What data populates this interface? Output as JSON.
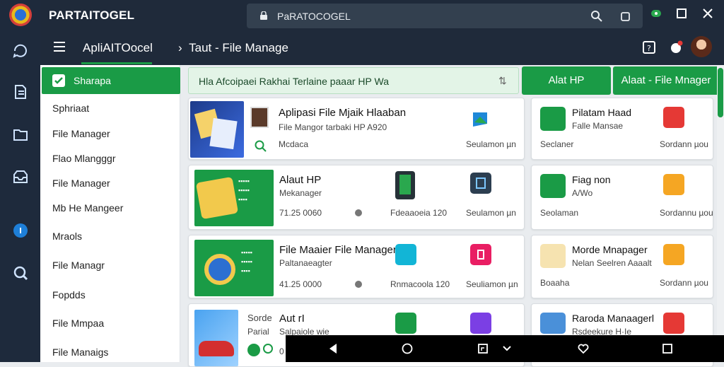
{
  "rail": {
    "icons": [
      "logo-icon",
      "chat-icon",
      "bookmark-icon",
      "folder-icon",
      "inbox-icon",
      "info-icon",
      "settings-icon"
    ]
  },
  "topbar": {
    "brand": "PARTAITOGEL",
    "url": "PaRATOCOGEL"
  },
  "appbar": {
    "app_name": "ApliAITOocel",
    "breadcrumb": "Taut - File Manage"
  },
  "sidebar": {
    "active": "Sharapa",
    "items": [
      "Sphriaat",
      "File Manager",
      "Flao Mlangggr",
      "File Manager",
      "Mb He Mangeer",
      "Mraols",
      "File Managr",
      "Fopdds",
      "File Mmpaa",
      "File Manaigs"
    ]
  },
  "banner": {
    "text": "Hla  Afcoipaei Rakhai Terlaine paaar HP Wa",
    "pin": "⇅"
  },
  "buttons": {
    "alat_hp": "Alat HP",
    "alat_file": "Alaat - File Mnager"
  },
  "cards": [
    {
      "title": "Aplipasi File Mjaik Hlaaban",
      "subtitle": "File Mangor tarbaki HP A920",
      "meta": "Mcdaca",
      "col2": "",
      "col3": "Seulamon µn"
    },
    {
      "title": "Alaut HP",
      "subtitle": "Mekanager",
      "meta": "71.25 0060",
      "col2": "Fdeaaoeia 120",
      "col3": "Seulamon µn"
    },
    {
      "title": "File Maaier File Manager",
      "subtitle": "Paltanaeagter",
      "meta": "41.25 0000",
      "col2": "Rnmacoola 120",
      "col3": "Seuliamon µn"
    },
    {
      "title": "Aut rI",
      "subtitle": "Salpaiole wie",
      "meta": "0",
      "col2": "Sorde",
      "col3": "Parial"
    }
  ],
  "side_cards": [
    {
      "title": "Pilatam Haad",
      "subtitle": "Falle Mansae",
      "left": "Seclaner",
      "right": "Sordann µou"
    },
    {
      "title": "Fiag non",
      "subtitle": "A/Wo",
      "left": "Seolaman",
      "right": "Sordannu µou"
    },
    {
      "title": "Morde Mnapager",
      "subtitle": "Nelan Seelren Aaaalt",
      "left": "Boaaha",
      "right": "Sordann µou"
    },
    {
      "title": "Raroda Manaagerl",
      "subtitle": "Rsdeekure H·Ie",
      "left": "",
      "right": ""
    }
  ],
  "colors": {
    "accent": "#1a9b46",
    "dark": "#1f2a3a"
  }
}
